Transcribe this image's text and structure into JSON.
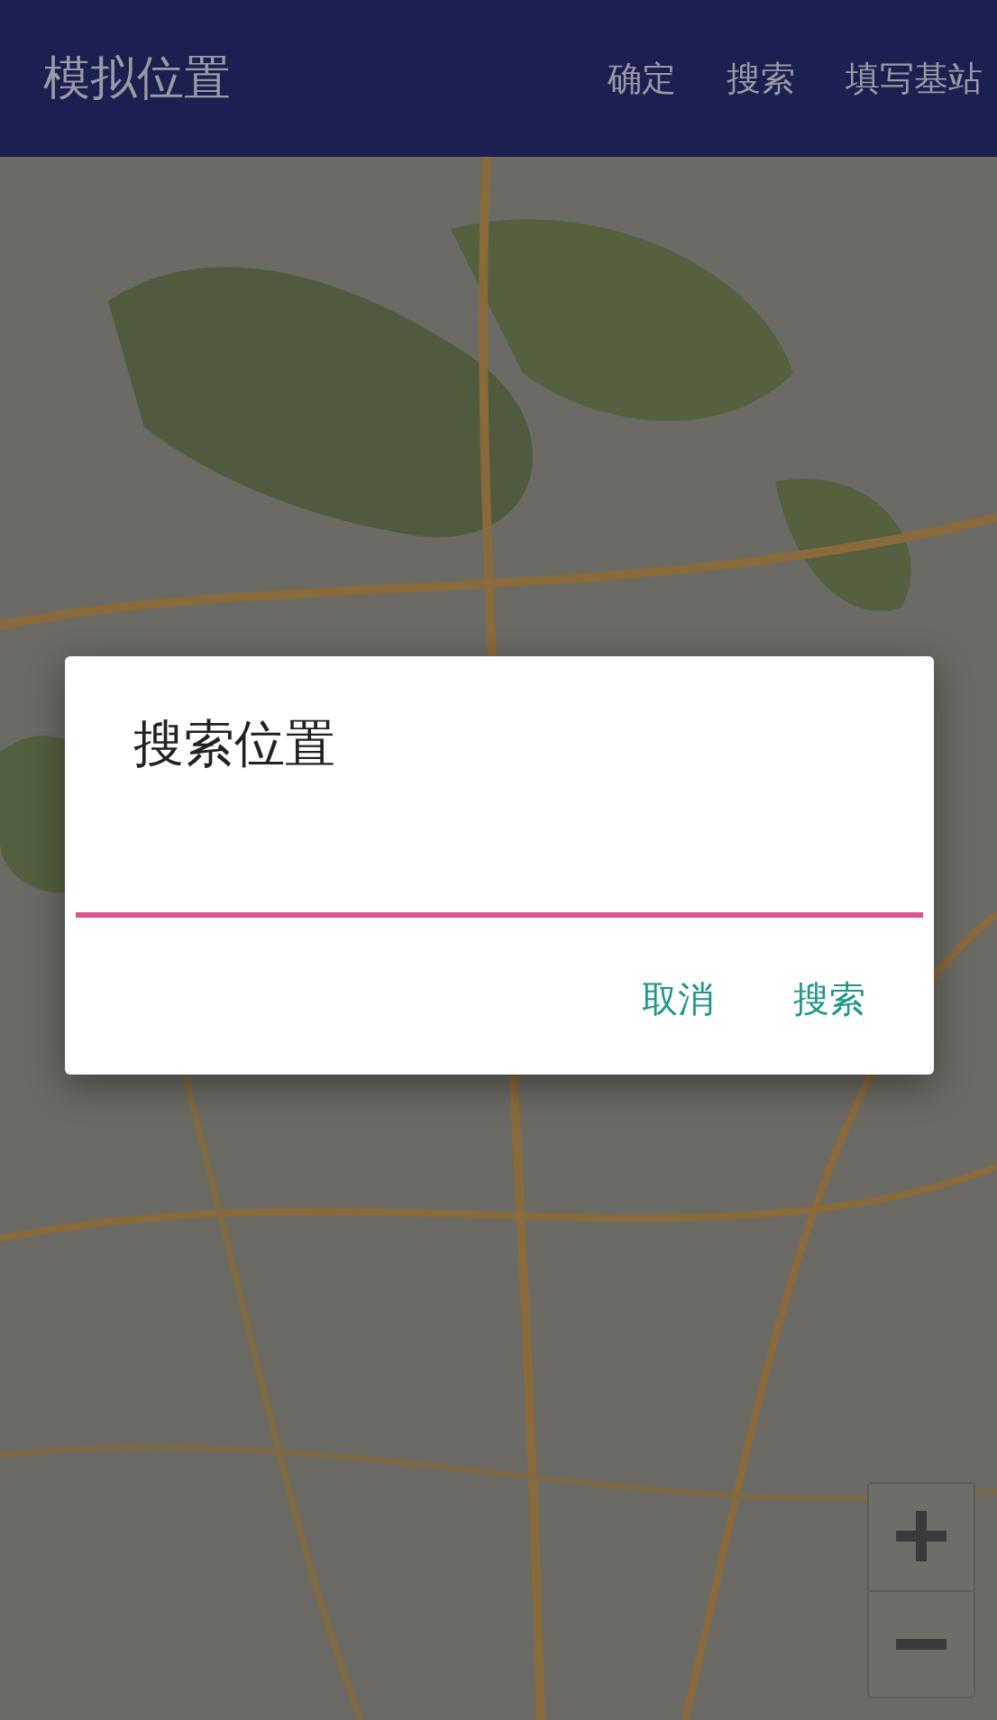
{
  "app_bar": {
    "title": "模拟位置",
    "actions": [
      "确定",
      "搜索",
      "填写基站"
    ]
  },
  "dialog": {
    "title": "搜索位置",
    "field": {
      "focused": true
    },
    "buttons": [
      "取消",
      "搜索"
    ]
  }
}
